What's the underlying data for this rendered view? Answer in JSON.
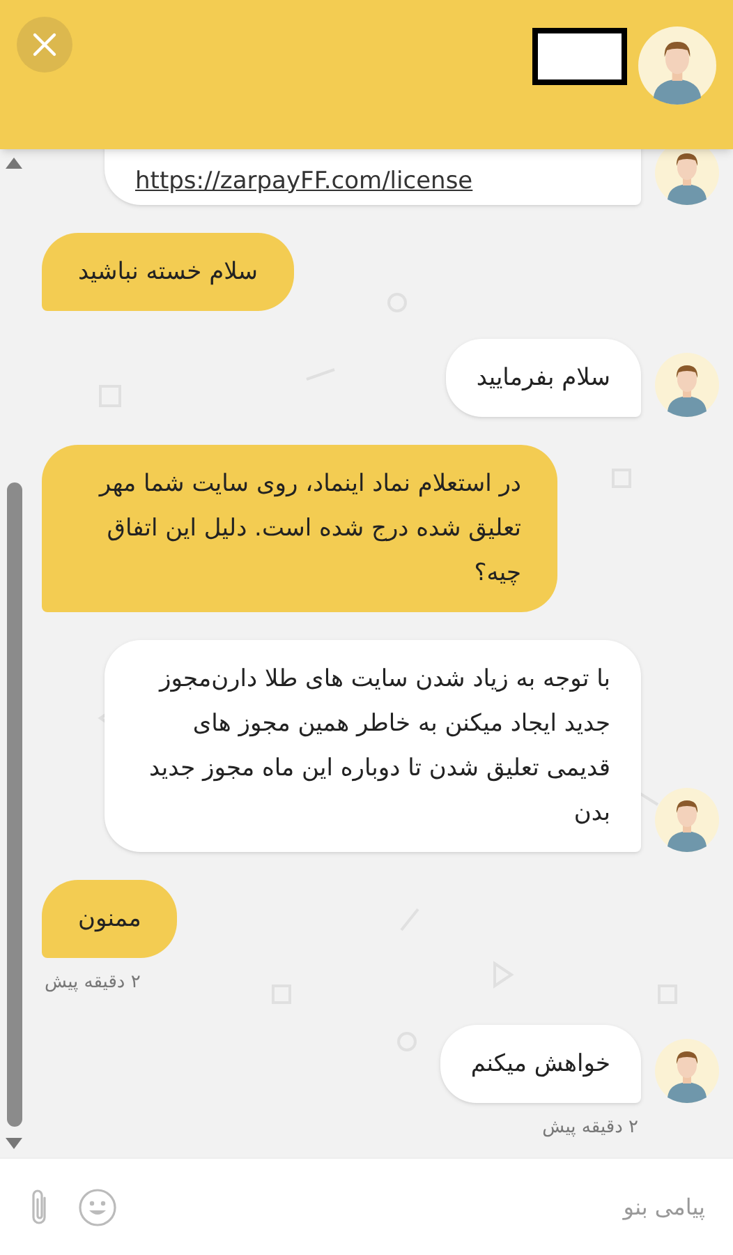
{
  "messages": [
    {
      "kind": "agent_link",
      "text": "https://zarpayFF.com/license"
    },
    {
      "kind": "user",
      "text": "سلام خسته نباشید"
    },
    {
      "kind": "agent",
      "text": "سلام بفرمایید"
    },
    {
      "kind": "user",
      "text": "در استعلام نماد اینماد، روی سایت شما مهر تعلیق شده درج شده است. دلیل این اتفاق چیه؟"
    },
    {
      "kind": "agent",
      "text": "با توجه به زیاد شدن سایت های طلا دارن‌مجوز جدید ایجاد میکنن به خاطر همین مجوز های قدیمی تعلیق شدن تا دوباره این ماه مجوز جدید بدن"
    },
    {
      "kind": "user",
      "text": "ممنون",
      "time": "۲ دقیقه پیش"
    },
    {
      "kind": "agent",
      "text": "خواهش میکنم",
      "time": "۲ دقیقه پیش"
    }
  ],
  "composer": {
    "placeholder": "پیامی بنو"
  }
}
